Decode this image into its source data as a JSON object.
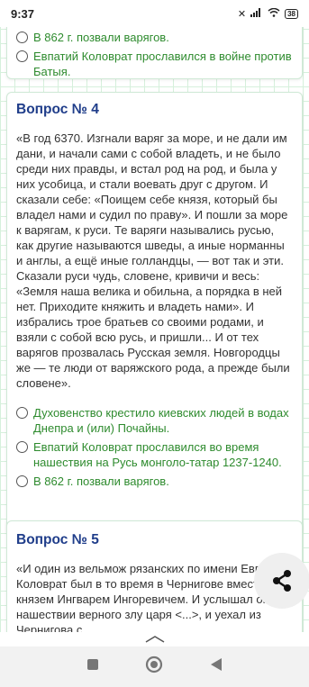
{
  "status": {
    "time": "9:37",
    "battery": "38"
  },
  "prev_card": {
    "options": [
      "В 862 г. позвали варягов.",
      "Евпатий Коловрат прославился в войне против Батыя."
    ]
  },
  "question4": {
    "title": "Вопрос № 4",
    "text": "«В год 6370. Изгнали варяг за море, и не дали им дани, и начали сами с собой владеть, и не было среди них правды, и встал род на род, и была у них усобица, и стали воевать друг с другом. И сказали себе: «Поищем себе князя, который бы владел нами и судил по праву». И пошли за море к варягам, к руси. Те варяги назывались русью, как другие называются шведы, а иные норманны и англы, а ещё иные голландцы, — вот так и эти. Сказали руси чудь, словене, кривичи и весь: «Земля наша велика и обильна, а порядка в ней нет. Приходите княжить и владеть нами». И избрались трое братьев со своими родами, и взяли с собой всю русь, и пришли... И от тех варягов прозвалась Русская земля. Новгородцы же — те люди от варяжского рода, а прежде были словене».",
    "options": [
      "Духовенство крестило киевских людей в водах Днепра и (или) Почайны.",
      "Евпатий Коловрат прославился во время нашествия на Русь монголо-татар 1237-1240.",
      "В 862 г. позвали варягов."
    ]
  },
  "question5": {
    "title": "Вопрос № 5",
    "text": "«И один из вельмож рязанских по имени Евпатий Коловрат был в то время в Чернигове вместе с князем Ингварем Ингоревичем. И услышал он о нашествии верного злу царя <...>, и уехал из Чернигова с"
  }
}
